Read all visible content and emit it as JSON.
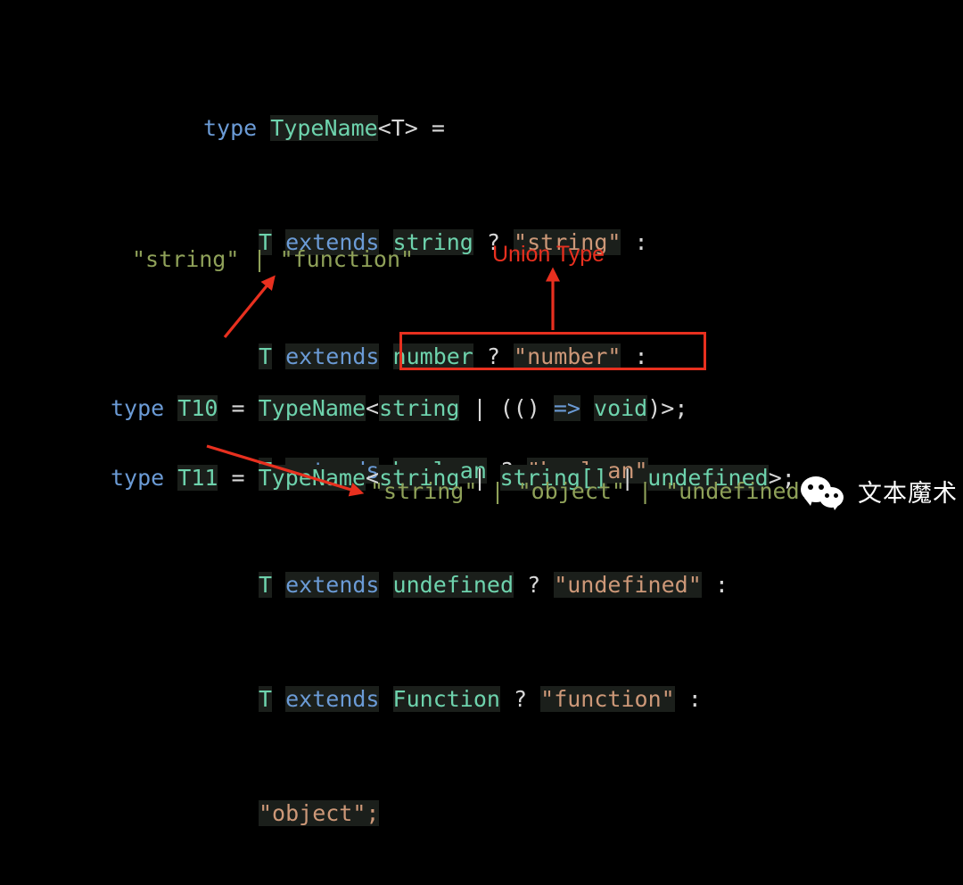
{
  "background_color": "#000000",
  "theme": {
    "keyword_color": "#6b9bd6",
    "type_color": "#6ed3ad",
    "punctuation_color": "#d8d8d8",
    "string_color": "#cd9878",
    "annotation_color": "#8fa159",
    "accent_red": "#e8301f"
  },
  "code": {
    "declaration": {
      "line1": {
        "kw_type": "type",
        "name": "TypeName",
        "generic": "<T>",
        "equals": "="
      },
      "conditional_lines": [
        {
          "param": "T",
          "kw_extends": "extends",
          "constraint": "string",
          "question": "?",
          "result": "\"string\"",
          "colon": ":"
        },
        {
          "param": "T",
          "kw_extends": "extends",
          "constraint": "number",
          "question": "?",
          "result": "\"number\"",
          "colon": ":"
        },
        {
          "param": "T",
          "kw_extends": "extends",
          "constraint": "boolean",
          "question": "?",
          "result": "\"boolean\"",
          "colon": ":"
        },
        {
          "param": "T",
          "kw_extends": "extends",
          "constraint": "undefined",
          "question": "?",
          "result": "\"undefined\"",
          "colon": ":"
        },
        {
          "param": "T",
          "kw_extends": "extends",
          "constraint": "Function",
          "question": "?",
          "result": "\"function\"",
          "colon": ":"
        }
      ],
      "fallback": "\"object\";"
    },
    "t10": {
      "kw_type": "type",
      "alias": "T10",
      "equals": "=",
      "generic_name": "TypeName",
      "open_angle": "<",
      "boxed_expression": "string | (() => void)",
      "boxed_parts": {
        "type1": "string",
        "bar": "|",
        "paren_open": "((",
        "arrow": "=>",
        "void": "void",
        "paren_close": ")"
      },
      "close_angle": ">",
      "semicolon": ";"
    },
    "t11": {
      "kw_type": "type",
      "alias": "T11",
      "equals": "=",
      "generic_name": "TypeName",
      "open_angle": "<",
      "type1": "string",
      "bar1": "|",
      "type2": "string[]",
      "bar2": "|",
      "type3": "undefined",
      "close_angle": ">",
      "semicolon": ";"
    }
  },
  "annotations": {
    "result_t10": "\"string\" | \"function\"",
    "result_t11": "\"string\" | \"object\" | \"undefined\"",
    "union_type_label": "Union Type"
  },
  "watermark": {
    "text": "文本魔术",
    "logo": "wechat-icon"
  }
}
